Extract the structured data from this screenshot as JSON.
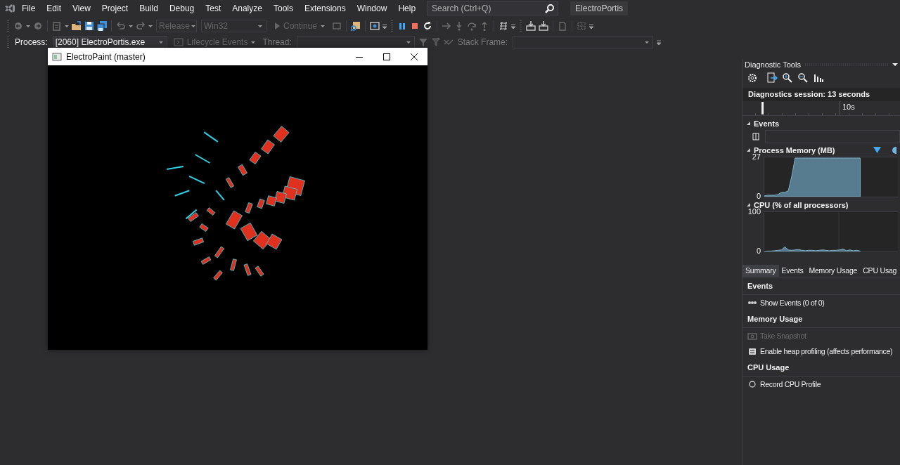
{
  "menu_bar": {
    "items": [
      "File",
      "Edit",
      "View",
      "Project",
      "Build",
      "Debug",
      "Test",
      "Analyze",
      "Tools",
      "Extensions",
      "Window",
      "Help"
    ],
    "search": {
      "placeholder": "Search (Ctrl+Q)"
    },
    "solution_name": "ElectroPortis"
  },
  "toolbar": {
    "configuration": {
      "value": "Release",
      "disabled": true
    },
    "platform": {
      "value": "Win32",
      "disabled": true
    },
    "continue_button": {
      "label": "Continue",
      "disabled": true
    }
  },
  "debug_location": {
    "process_label": "Process:",
    "process": "[2060] ElectroPortis.exe",
    "lifecycle_events": {
      "label": "Lifecycle Events",
      "disabled": true
    },
    "thread_label": {
      "label": "Thread:",
      "disabled": true
    },
    "stack_frame_label": {
      "label": "Stack Frame:",
      "disabled": true
    }
  },
  "app_window": {
    "title": "ElectroPaint (master)"
  },
  "diagnostic_tools": {
    "title": "Diagnostic Tools",
    "session": "Diagnostics session: 13 seconds",
    "timeline_label": "10s",
    "events_track": {
      "title": "Events"
    },
    "memory": {
      "title": "Process Memory (MB)",
      "chart_data": {
        "type": "area",
        "ylim": [
          0,
          27
        ],
        "yticks": [
          0,
          27
        ],
        "values": [
          0.5,
          1,
          1,
          1,
          1.5,
          3,
          3,
          4,
          14,
          26.5,
          26.5,
          26.5,
          26.5,
          26.5,
          26.5,
          26.5,
          26.5,
          26.5,
          26.5,
          26.5,
          26.5,
          26.5,
          26.5,
          26.5,
          26.5,
          26.5,
          26.5,
          26.5,
          26.5,
          null,
          null,
          null,
          null,
          null,
          null,
          null,
          null,
          null,
          null,
          null
        ]
      }
    },
    "cpu": {
      "title": "CPU (% of all processors)",
      "chart_data": {
        "type": "area",
        "ylim": [
          0,
          100
        ],
        "yticks": [
          0,
          100
        ],
        "values": [
          0,
          1,
          1,
          2,
          3,
          4,
          12,
          4,
          3,
          4,
          5,
          3,
          2,
          3,
          3,
          2,
          3,
          4,
          3,
          2,
          3,
          3,
          4,
          6,
          2,
          4,
          2,
          3,
          1,
          null,
          null,
          null,
          null,
          null,
          null,
          null,
          null,
          null,
          null,
          null
        ]
      }
    },
    "tabs": [
      {
        "label": "Summary",
        "selected": true
      },
      {
        "label": "Events",
        "selected": false
      },
      {
        "label": "Memory Usage",
        "selected": false
      },
      {
        "label": "CPU Usag",
        "selected": false
      }
    ],
    "summary_sections": [
      {
        "heading": "Events",
        "actions": [
          {
            "kind": "events",
            "label": "Show Events (0 of 0)",
            "disabled": false
          }
        ]
      },
      {
        "heading": "Memory Usage",
        "actions": [
          {
            "kind": "snapshot",
            "label": "Take Snapshot",
            "disabled": true
          },
          {
            "kind": "heap",
            "label": "Enable heap profiling (affects performance)",
            "disabled": false
          }
        ]
      },
      {
        "heading": "CPU Usage",
        "actions": [
          {
            "kind": "record",
            "label": "Record CPU Profile",
            "disabled": false
          }
        ]
      }
    ]
  }
}
